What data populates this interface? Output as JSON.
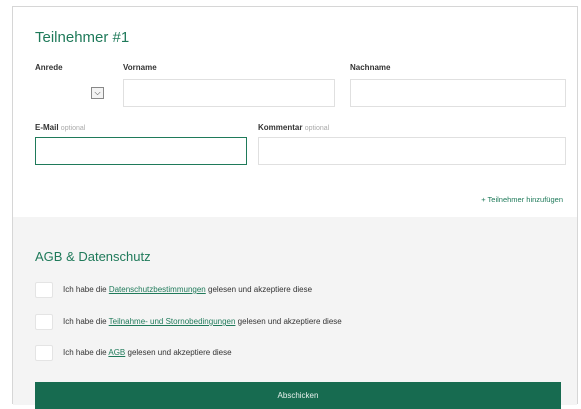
{
  "participant": {
    "title": "Teilnehmer #1",
    "anrede_label": "Anrede",
    "vorname_label": "Vorname",
    "nachname_label": "Nachname",
    "email_label": "E-Mail",
    "email_optional": "optional",
    "kommentar_label": "Kommentar",
    "kommentar_optional": "optional",
    "anrede_value": "",
    "vorname_value": "",
    "nachname_value": "",
    "email_value": "",
    "kommentar_value": ""
  },
  "add_participant": "+ Teilnehmer hinzufügen",
  "agb": {
    "title": "AGB & Datenschutz",
    "rows": [
      {
        "prefix": "Ich habe die ",
        "link": "Datenschutzbestimmungen",
        "suffix": " gelesen und akzeptiere diese"
      },
      {
        "prefix": "Ich habe die ",
        "link": "Teilnahme- und Stornobedingungen",
        "suffix": " gelesen und akzeptiere diese"
      },
      {
        "prefix": "Ich habe die ",
        "link": "AGB",
        "suffix": " gelesen und akzeptiere diese"
      }
    ]
  },
  "submit_label": "Abschicken",
  "colors": {
    "accent": "#1f7a5a",
    "button": "#176b50"
  }
}
